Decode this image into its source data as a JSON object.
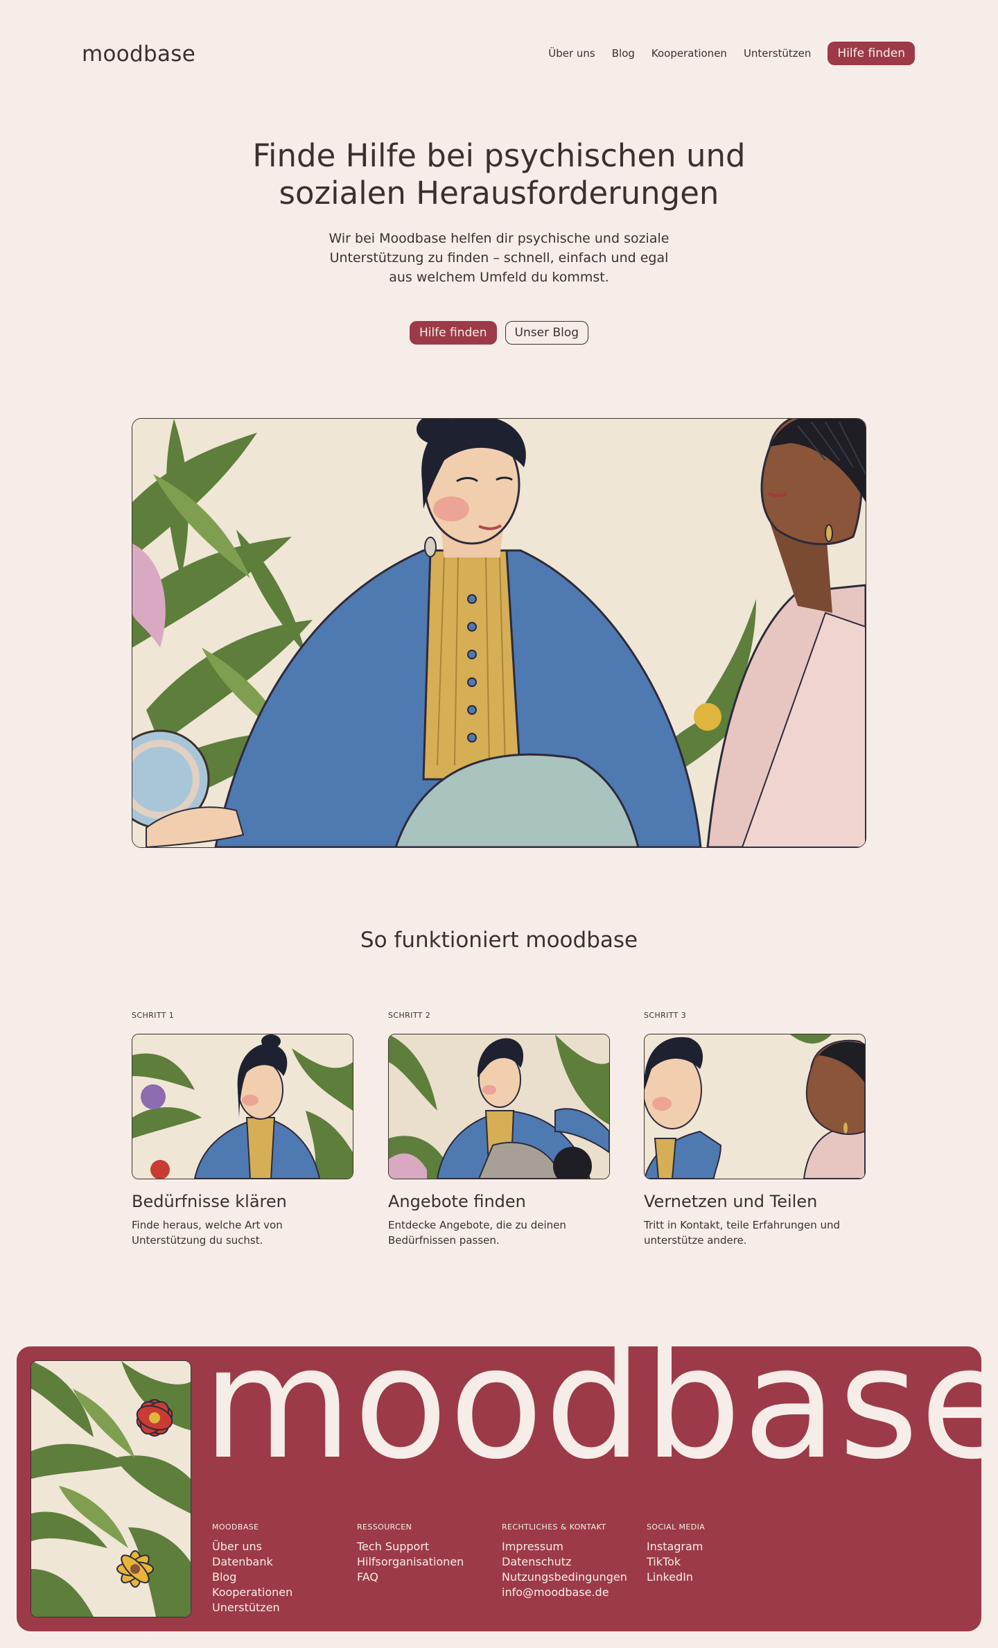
{
  "nav": {
    "logo": "moodbase",
    "links": [
      "Über uns",
      "Blog",
      "Kooperationen",
      "Unterstützen"
    ],
    "cta": "Hilfe finden"
  },
  "hero": {
    "title_line1": "Finde Hilfe bei psychischen und",
    "title_line2": "sozialen Herausforderungen",
    "subtitle": "Wir bei Moodbase helfen dir psychische und soziale Unterstützung zu finden – schnell, einfach und egal aus welchem Umfeld du kommst.",
    "primary_button": "Hilfe finden",
    "secondary_button": "Unser Blog"
  },
  "how": {
    "title": "So funktioniert moodbase",
    "steps": [
      {
        "label": "SCHRITT 1",
        "title": "Bedürfnisse klären",
        "text": "Finde heraus, welche Art von Unterstützung du suchst."
      },
      {
        "label": "SCHRITT 2",
        "title": "Angebote finden",
        "text": "Entdecke Angebote, die zu deinen Bedürfnissen passen."
      },
      {
        "label": "SCHRITT 3",
        "title": "Vernetzen und Teilen",
        "text": "Tritt in Kontakt, teile Erfahrungen und unterstütze andere."
      }
    ]
  },
  "footer": {
    "wordmark": "moodbase",
    "columns": [
      {
        "heading": "MOODBASE",
        "links": [
          "Über uns",
          "Datenbank",
          "Blog",
          "Kooperationen",
          "Unerstützen"
        ]
      },
      {
        "heading": "RESSOURCEN",
        "links": [
          "Tech Support",
          "Hilfsorganisationen",
          "FAQ"
        ]
      },
      {
        "heading": "RECHTLICHES & KONTAKT",
        "links": [
          "Impressum",
          "Datenschutz",
          "Nutzungsbedingungen",
          "info@moodbase.de"
        ]
      },
      {
        "heading": "SOCIAL MEDIA",
        "links": [
          "Instagram",
          "TikTok",
          "LinkedIn"
        ]
      }
    ]
  },
  "colors": {
    "background": "#f6ede8",
    "accent": "#9c3a49",
    "text": "#3b302d"
  }
}
